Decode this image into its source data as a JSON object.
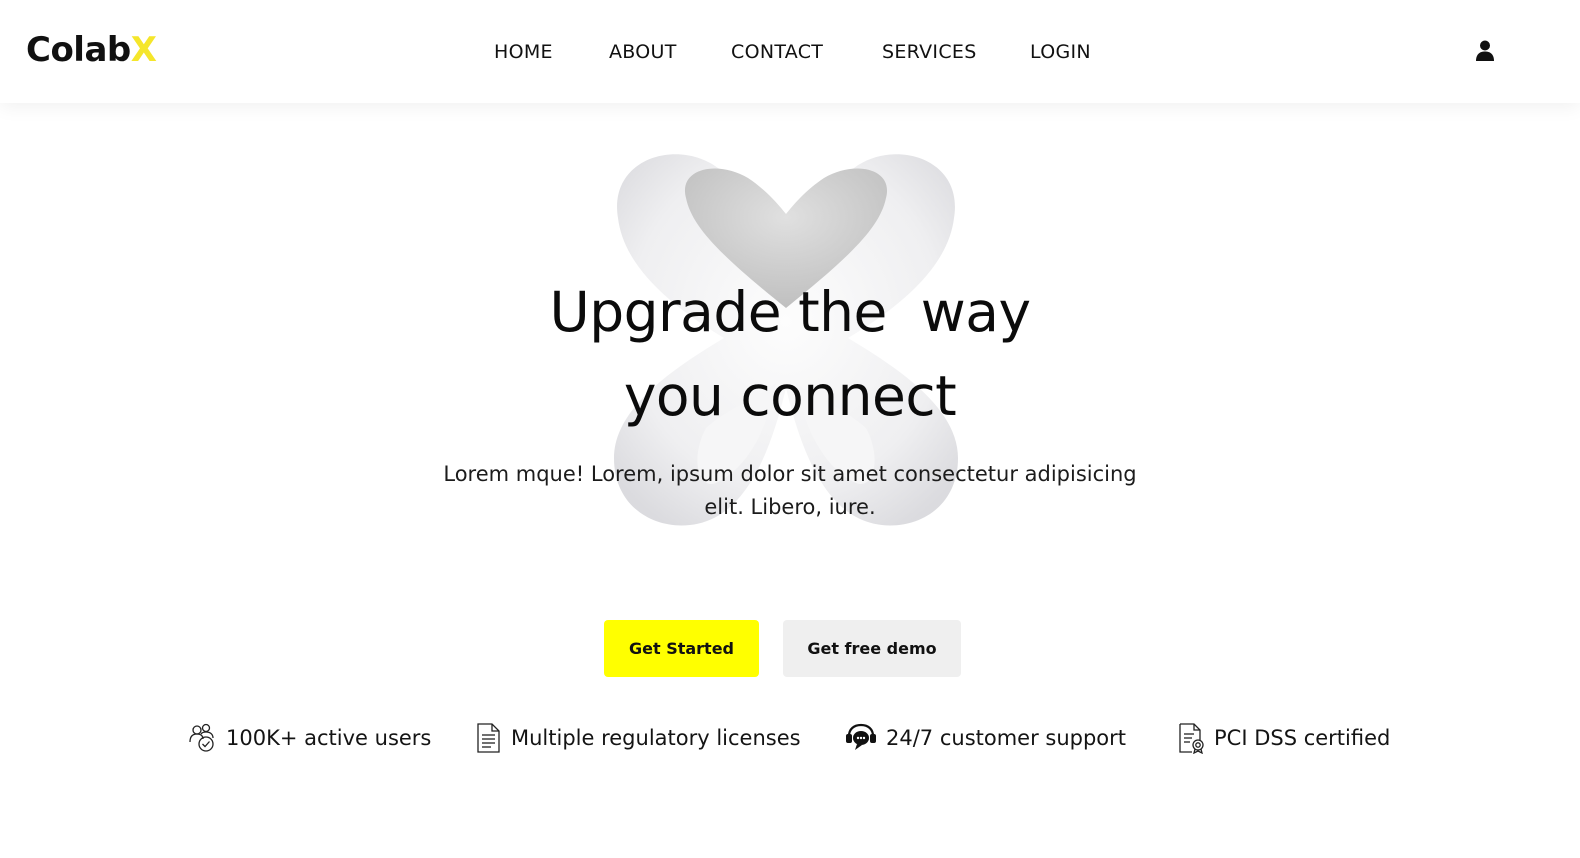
{
  "brand": {
    "name_main": "Colab",
    "name_accent": "X",
    "accent_color": "#f5e62b"
  },
  "nav": {
    "links": [
      {
        "label": "HOME"
      },
      {
        "label": "ABOUT"
      },
      {
        "label": "CONTACT"
      },
      {
        "label": "SERVICES"
      },
      {
        "label": "LOGIN"
      }
    ],
    "user_icon": "user-icon"
  },
  "hero": {
    "title_line1": "Upgrade the  way",
    "title_line2": "you connect",
    "subtitle": "Lorem mque! Lorem, ipsum dolor sit amet consectetur adipisicing elit. Libero, iure.",
    "art_icon": "white-3d-x-shape"
  },
  "buttons": {
    "primary": {
      "label": "Get Started",
      "color": "#ffff00"
    },
    "secondary": {
      "label": "Get free demo",
      "color": "#efefef"
    }
  },
  "features": [
    {
      "label": "100K+ active users",
      "icon": "users-check-icon"
    },
    {
      "label": "Multiple regulatory licenses",
      "icon": "document-icon"
    },
    {
      "label": "24/7 customer support",
      "icon": "chat-support-icon"
    },
    {
      "label": "PCI DSS certified",
      "icon": "certificate-icon"
    }
  ]
}
